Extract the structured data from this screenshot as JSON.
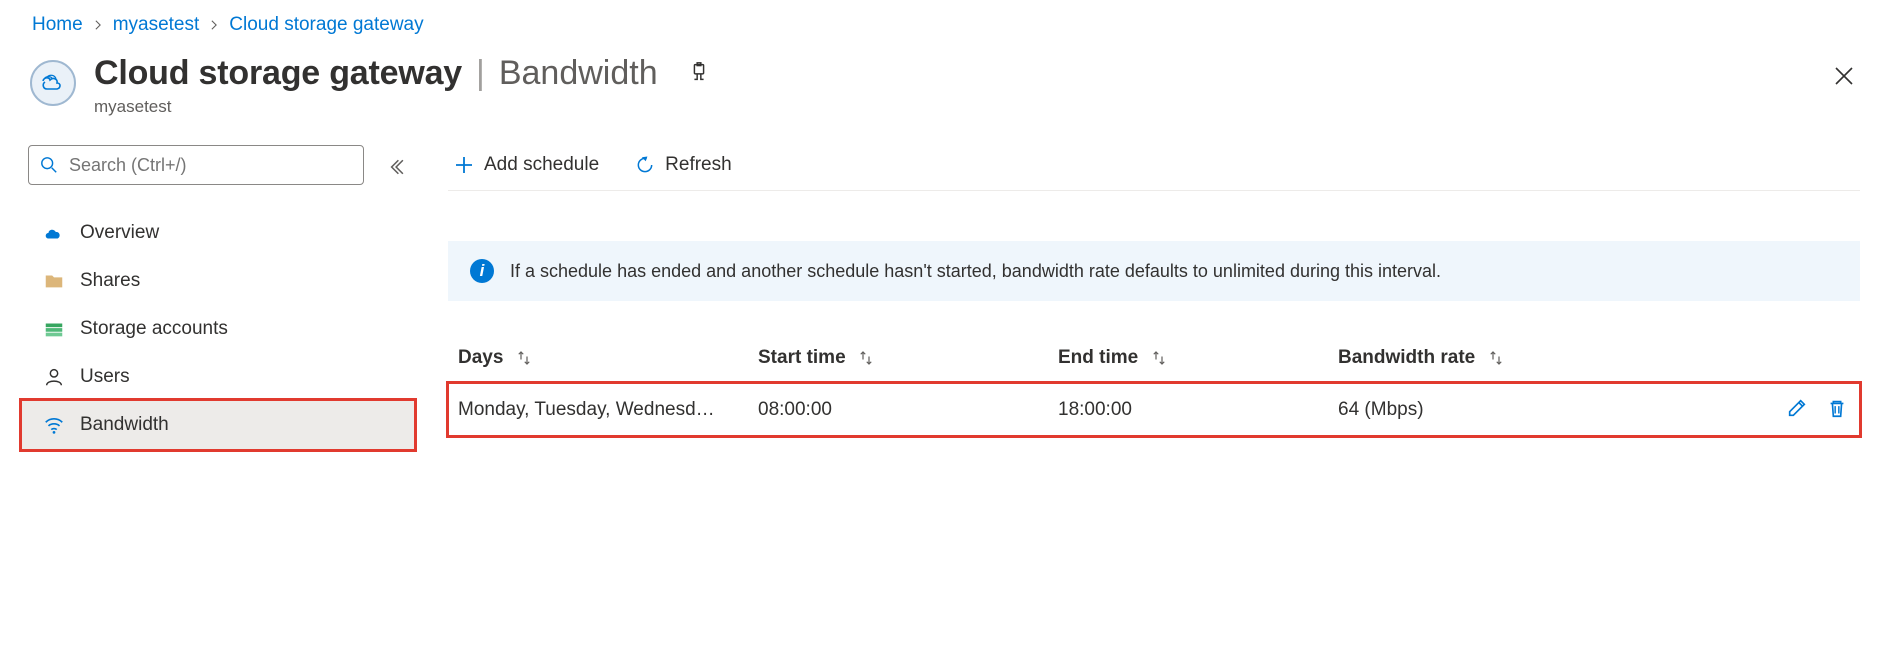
{
  "breadcrumb": {
    "home": "Home",
    "resource": "myasetest",
    "page": "Cloud storage gateway"
  },
  "header": {
    "title": "Cloud storage gateway",
    "subtitle": "Bandwidth",
    "resource_name": "myasetest"
  },
  "sidebar": {
    "search_placeholder": "Search (Ctrl+/)",
    "items": [
      {
        "label": "Overview",
        "active": false
      },
      {
        "label": "Shares",
        "active": false
      },
      {
        "label": "Storage accounts",
        "active": false
      },
      {
        "label": "Users",
        "active": false
      },
      {
        "label": "Bandwidth",
        "active": true
      }
    ]
  },
  "commands": {
    "add_schedule": "Add schedule",
    "refresh": "Refresh"
  },
  "info_banner": "If a schedule has ended and another schedule hasn't started, bandwidth rate defaults to unlimited during this interval.",
  "table": {
    "columns": {
      "days": "Days",
      "start": "Start time",
      "end": "End time",
      "rate": "Bandwidth rate"
    },
    "rows": [
      {
        "days": "Monday, Tuesday, Wednesd…",
        "start": "08:00:00",
        "end": "18:00:00",
        "rate": "64 (Mbps)"
      }
    ]
  }
}
